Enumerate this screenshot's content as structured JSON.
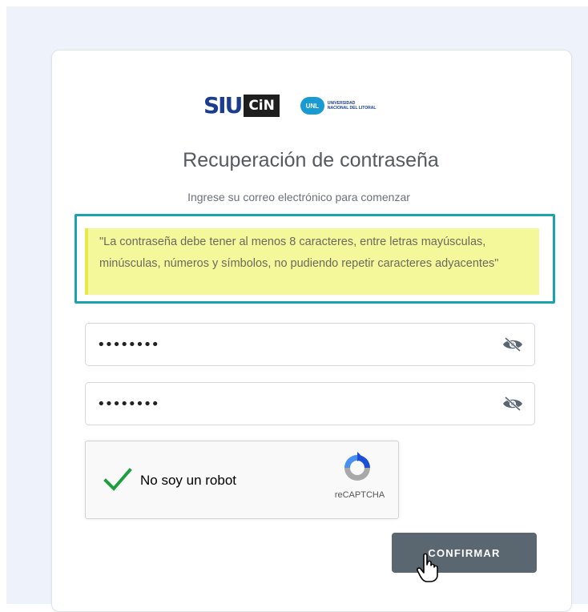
{
  "logos": {
    "siu": "SIU",
    "cin": "CiN",
    "unl_badge": "UNL",
    "unl_name_line1": "UNIVERSIDAD",
    "unl_name_line2": "NACIONAL DEL LITORAL"
  },
  "title": "Recuperación de contraseña",
  "subtitle": "Ingrese su correo electrónico para comenzar",
  "notice": "\"La contraseña debe tener al menos 8 caracteres, entre letras mayúsculas, minúsculas, números y símbolos, no pudiendo repetir caracteres adyacentes\"",
  "fields": [
    {
      "value": "••••••••",
      "toggle_icon": "eye-slash-icon"
    },
    {
      "value": "••••••••",
      "toggle_icon": "eye-slash-icon"
    }
  ],
  "captcha": {
    "label": "No soy un robot",
    "brand": "reCAPTCHA",
    "checked": true
  },
  "confirm_button": "CONFIRMAR",
  "colors": {
    "accent_frame": "#1aa3ae",
    "notice_bg": "#f5f89a",
    "button_bg": "#5a6670",
    "check_green": "#1e9e40"
  }
}
